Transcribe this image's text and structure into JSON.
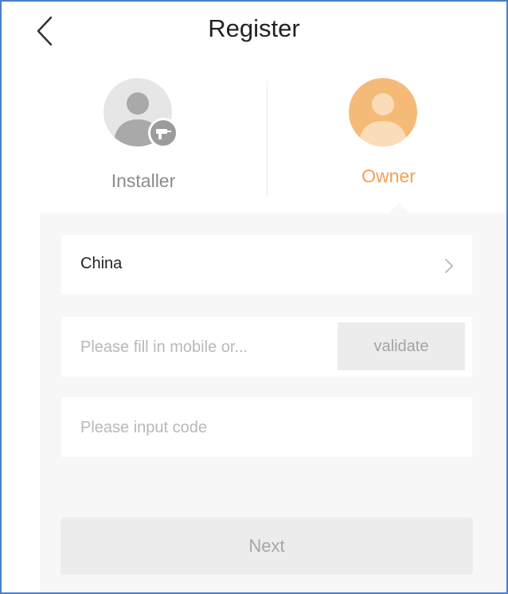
{
  "header": {
    "title": "Register",
    "back_icon": "chevron-left-icon"
  },
  "roles": [
    {
      "label": "Installer",
      "icon": "user-avatar-icon",
      "badge_icon": "drill-icon",
      "selected": false,
      "color": "#8c8c8c"
    },
    {
      "label": "Owner",
      "icon": "user-avatar-icon",
      "selected": true,
      "color": "#f1a14f"
    }
  ],
  "form": {
    "country": {
      "value": "China",
      "icon": "chevron-right-icon"
    },
    "mobile": {
      "placeholder": "Please fill in mobile or...",
      "value": "",
      "validate_label": "validate"
    },
    "code": {
      "placeholder": "Please input code",
      "value": ""
    },
    "next_label": "Next"
  },
  "colors": {
    "accent": "#f1a14f",
    "accent_light": "#f6ba78",
    "frame_border": "#4a7fc6",
    "panel_background": "#f7f7f7",
    "disabled_button": "#ececec"
  }
}
